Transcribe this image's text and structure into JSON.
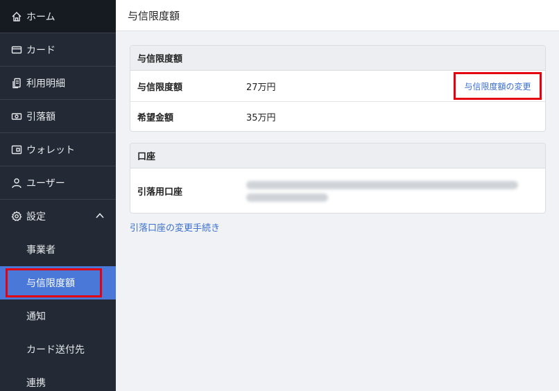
{
  "sidebar": {
    "items": [
      {
        "label": "ホーム",
        "icon": "home-icon"
      },
      {
        "label": "カード",
        "icon": "card-icon"
      },
      {
        "label": "利用明細",
        "icon": "statement-icon"
      },
      {
        "label": "引落額",
        "icon": "money-icon"
      },
      {
        "label": "ウォレット",
        "icon": "wallet-icon"
      },
      {
        "label": "ユーザー",
        "icon": "user-icon"
      },
      {
        "label": "設定",
        "icon": "gear-icon"
      }
    ],
    "settings_sub": [
      "事業者",
      "与信限度額",
      "通知",
      "カード送付先",
      "連携"
    ]
  },
  "header": {
    "title": "与信限度額"
  },
  "credit_card": {
    "title": "与信限度額",
    "rows": [
      {
        "label": "与信限度額",
        "value": "27万円"
      },
      {
        "label": "希望金額",
        "value": "35万円"
      }
    ],
    "change_link": "与信限度額の変更"
  },
  "account_card": {
    "title": "口座",
    "row_label": "引落用口座"
  },
  "procedure_link": "引落口座の変更手続き",
  "colors": {
    "sidebar_bg": "#232a35",
    "active_bg": "#4a78d8",
    "link": "#3a6fd0",
    "highlight": "#e3000f"
  }
}
